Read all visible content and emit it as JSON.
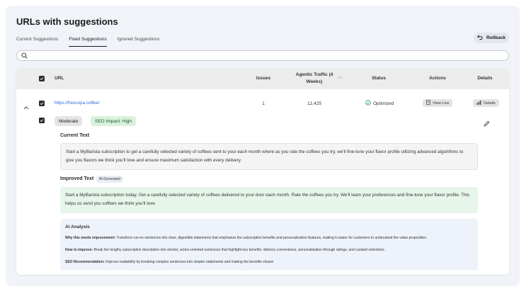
{
  "page": {
    "title": "URLs with suggestions"
  },
  "tabs": [
    "Current Suggestions",
    "Fixed Suggestions",
    "Ignored Suggestions"
  ],
  "active_tab": "Fixed Suggestions",
  "rollback": {
    "label": "Rollback"
  },
  "search": {
    "placeholder": ""
  },
  "table": {
    "headers": {
      "url": "URL",
      "issues": "Issues",
      "traffic": "Agentic Traffic (4 Weeks)",
      "status": "Status",
      "actions": "Actions",
      "details": "Details"
    },
    "row": {
      "url": "https://frescopa.coffee/",
      "issues": "1",
      "traffic": "12,425",
      "status": "Optimized",
      "view_live": "View Live",
      "details": "Details"
    }
  },
  "suggestion": {
    "severity": "Moderate",
    "impact": "SEO Impact: High",
    "current_title": "Current Text",
    "current_text": "Start a MyBarista subscription to get a carefully selected variety of coffees sent to your each month where as you rate the coffees you try, we'll fine-tune your flavor profile utilizing advanced algorithms to give you flavors we think you'll love and ensure maximum satisfaction with every delivery.",
    "improved_title": "Improved Text",
    "ai_badge": "AI-Generated",
    "improved_text": "Start a MyBarista subscription today. Get a carefully selected variety of coffees delivered to your door each month. Rate the coffees you try. We'll learn your preferences and fine-tune your flavor profile. This helps us send you coffees we think you'll love.",
    "analysis_title": "AI Analysis",
    "why_label": "Why this needs improvement:",
    "why_text": "Transform run-on sentences into clear, digestible statements that emphasize the subscription benefits and personalization features, making it easier for customers to understand the value proposition.",
    "how_label": "How to improve:",
    "how_text": "Break the lengthy subscription description into shorter, action-oriented sentences that highlight key benefits: delivery convenience, personalization through ratings, and curated selections.",
    "seo_label": "SEO Recommendation:",
    "seo_text": "Improve readability by breaking complex sentences into simpler statements and making the benefits clearer"
  },
  "colors": {
    "improved_bg": "#e6f6ea",
    "impact_bg": "#d9f2dd",
    "analysis_bg": "#eef3fb",
    "status_green": "#2f9e55",
    "link": "#2e6bd6"
  }
}
